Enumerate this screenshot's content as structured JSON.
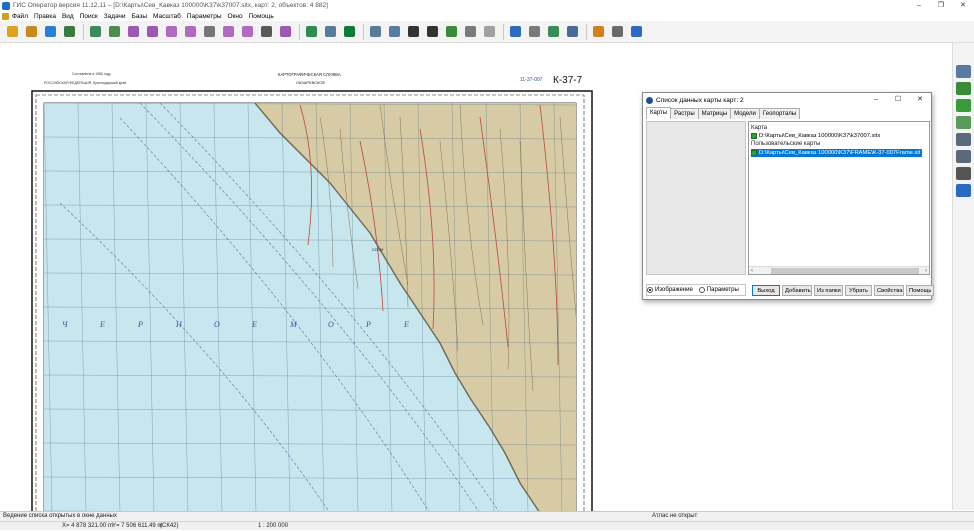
{
  "window": {
    "title": "ГИС Оператор версия 11.12.11 – [D:\\Карты\\Сев_Кавказ 100000\\K37\\k37007.sitx, карт: 2, объектов: 4 882]",
    "controls": [
      "–",
      "❐",
      "✕"
    ]
  },
  "menu": [
    {
      "label": "Файл"
    },
    {
      "label": "Правка"
    },
    {
      "label": "Вид"
    },
    {
      "label": "Поиск"
    },
    {
      "label": "Задачи"
    },
    {
      "label": "Базы"
    },
    {
      "label": "Масштаб"
    },
    {
      "label": "Параметры"
    },
    {
      "label": "Окно"
    },
    {
      "label": "Помощь"
    }
  ],
  "toolbar": {
    "icons": [
      {
        "name": "open-folder-icon",
        "color": "#e0a020"
      },
      {
        "name": "open-map-icon",
        "color": "#c88a1a"
      },
      {
        "name": "layers-icon",
        "color": "#2a7fd0"
      },
      {
        "name": "network-icon",
        "color": "#3a7a3a"
      },
      {
        "name": "sep"
      },
      {
        "name": "stack-icon",
        "color": "#3a8a5a"
      },
      {
        "name": "grid-select-icon",
        "color": "#4c8c4c"
      },
      {
        "name": "pen-icon",
        "color": "#9b59b6"
      },
      {
        "name": "pen-text-icon",
        "color": "#9b59b6"
      },
      {
        "name": "pen-edit-icon",
        "color": "#b06ac0"
      },
      {
        "name": "pen-select-icon",
        "color": "#b06ac0"
      },
      {
        "name": "frame-select-icon",
        "color": "#777777"
      },
      {
        "name": "pen-add-icon",
        "color": "#b06ac0"
      },
      {
        "name": "pen-delete-icon",
        "color": "#b06ac0"
      },
      {
        "name": "list-icon",
        "color": "#5a5a5a"
      },
      {
        "name": "pen-move-icon",
        "color": "#9b59b6"
      },
      {
        "name": "sep"
      },
      {
        "name": "table-icon",
        "color": "#2e8b57"
      },
      {
        "name": "map-3d-icon",
        "color": "#5a7a9a"
      },
      {
        "name": "lightning-icon",
        "color": "#0f7a3a"
      },
      {
        "name": "sep"
      },
      {
        "name": "zoom-frame-icon",
        "color": "#5a7aa0"
      },
      {
        "name": "zoom-in-icon",
        "color": "#5a7aa0"
      },
      {
        "name": "scale-1-1-icon",
        "color": "#333333"
      },
      {
        "name": "fit-icon",
        "color": "#333333"
      },
      {
        "name": "check-frame-icon",
        "color": "#3a8a3a"
      },
      {
        "name": "undo-arrow-icon",
        "color": "#7a7a7a"
      },
      {
        "name": "pointer-icon",
        "color": "#a0a0a0"
      },
      {
        "name": "sep"
      },
      {
        "name": "grid-table-icon",
        "color": "#2a6ac0"
      },
      {
        "name": "label-a-icon",
        "color": "#7a7a7a"
      },
      {
        "name": "flag-icon",
        "color": "#3a8a5a"
      },
      {
        "name": "report-icon",
        "color": "#4a6a9a"
      },
      {
        "name": "sep"
      },
      {
        "name": "brush-icon",
        "color": "#d08020"
      },
      {
        "name": "printer-icon",
        "color": "#6a6a6a"
      },
      {
        "name": "help-question-icon",
        "color": "#2a6ac0"
      }
    ]
  },
  "right_toolbar": {
    "icons": [
      {
        "name": "panel-pin-icon",
        "color": "#5a7aa0"
      },
      {
        "name": "pen-green-icon",
        "color": "#3a8a3a"
      },
      {
        "name": "green-layers-icon",
        "color": "#3a9a3a"
      },
      {
        "name": "table-green-icon",
        "color": "#5a9a5a"
      },
      {
        "name": "window-grid-icon",
        "color": "#5a6a7a"
      },
      {
        "name": "window-split-icon",
        "color": "#5a6a7a"
      },
      {
        "name": "stamp-icon",
        "color": "#555555"
      },
      {
        "name": "door-exit-icon",
        "color": "#2a6ac0"
      }
    ]
  },
  "map": {
    "header_left_1": "Составлена в 1980 году",
    "header_left_2": "РОССИЙСКАЯ ФЕДЕРАЦИЯ, Краснодарский край",
    "header_center_1": "КАРТОГРАФИЧЕСКАЯ СЛУЖБА",
    "header_center_2": "ЛАЗАРЕВСКОЕ",
    "sheet_small": "11-37-007",
    "sheet_number": "К-37-7",
    "sea_label": [
      "Ч",
      "Е",
      "Р",
      "Н",
      "О",
      "Е",
      "М",
      "О",
      "Р",
      "Е"
    ],
    "city_label": "СОЧИ",
    "colors": {
      "sea": "#c8e6ee",
      "land": "#d6cba5",
      "grid": "#3c5a78",
      "frame": "#222222"
    }
  },
  "dialog": {
    "title": "Список данных карты  карт: 2",
    "controls": [
      "–",
      "☐",
      "✕"
    ],
    "tabs": [
      "Карты",
      "Растры",
      "Матрицы",
      "Модели",
      "Геопорталы"
    ],
    "groups": {
      "maps": "Карта",
      "user_maps": "Пользовательские карты"
    },
    "items": [
      {
        "path": "D:\\Карты\\Сев_Кавказ 100000\\K37\\k37007.sitx",
        "selected": false
      },
      {
        "path": "D:\\Карты\\Сев_Кавказ 100000\\K37\\FRAME\\К-37-007Frame.sit",
        "selected": true
      }
    ],
    "radio_image": "Изображение",
    "radio_params": "Параметры",
    "buttons": {
      "exit": "Выход",
      "add": "Добавить",
      "from_folder": "Из папки",
      "remove": "Убрать",
      "properties": "Свойства",
      "help": "Помощь"
    }
  },
  "status": {
    "message": "Ведение списка открытых в окне данных",
    "atlas": "Атлас не открыт",
    "coord_x": "X= 4 878 321.00 m",
    "coord_y": "Y= 7 506 611.49 m",
    "crs": "(СК42)",
    "scale": "1 : 200 000"
  }
}
